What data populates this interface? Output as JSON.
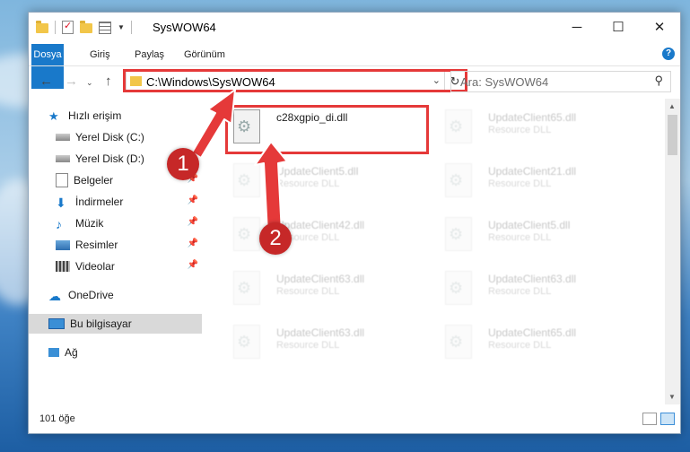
{
  "window": {
    "title": "SysWOW64",
    "controls": {
      "minimize": "─",
      "maximize": "☐",
      "close": "✕"
    }
  },
  "ribbon": {
    "tabs": [
      "Dosya",
      "Giriş",
      "Paylaş",
      "Görünüm"
    ],
    "help": "?"
  },
  "navigation": {
    "back": "←",
    "forward": "→",
    "up": "↑",
    "address": "C:\\Windows\\SysWOW64",
    "refresh": "↻",
    "dropdown": "⌄",
    "search_placeholder": "Ara: SysWOW64",
    "search_icon": "⚲"
  },
  "sidebar": {
    "items": [
      {
        "label": "Hızlı erişim",
        "icon": "star-icon"
      },
      {
        "label": "Yerel Disk (C:)",
        "icon": "drive-icon"
      },
      {
        "label": "Yerel Disk (D:)",
        "icon": "drive-icon"
      },
      {
        "label": "Belgeler",
        "icon": "documents-icon",
        "pinned": true
      },
      {
        "label": "İndirmeler",
        "icon": "download-icon",
        "pinned": true
      },
      {
        "label": "Müzik",
        "icon": "music-icon",
        "pinned": true
      },
      {
        "label": "Resimler",
        "icon": "pictures-icon",
        "pinned": true
      },
      {
        "label": "Videolar",
        "icon": "videos-icon",
        "pinned": true
      },
      {
        "label": "OneDrive",
        "icon": "cloud-icon"
      },
      {
        "label": "Bu bilgisayar",
        "icon": "computer-icon",
        "selected": true
      },
      {
        "label": "Ağ",
        "icon": "network-icon"
      }
    ]
  },
  "files": [
    {
      "name": "c28xgpio_di.dll",
      "type": ""
    },
    {
      "name": "UpdateClient65.dll",
      "type": "Resource DLL"
    },
    {
      "name": "UpdateClient5.dll",
      "type": "Resource DLL"
    },
    {
      "name": "UpdateClient21.dll",
      "type": "Resource DLL"
    },
    {
      "name": "UpdateClient42.dll",
      "type": "Resource DLL"
    },
    {
      "name": "UpdateClient5.dll",
      "type": "Resource DLL"
    },
    {
      "name": "UpdateClient63.dll",
      "type": "Resource DLL"
    },
    {
      "name": "UpdateClient63.dll",
      "type": "Resource DLL"
    },
    {
      "name": "UpdateClient63.dll",
      "type": "Resource DLL"
    },
    {
      "name": "UpdateClient65.dll",
      "type": "Resource DLL"
    }
  ],
  "status": {
    "count": "101 öğe"
  },
  "annotations": {
    "step1": "1",
    "step2": "2",
    "color": "#e53939"
  }
}
